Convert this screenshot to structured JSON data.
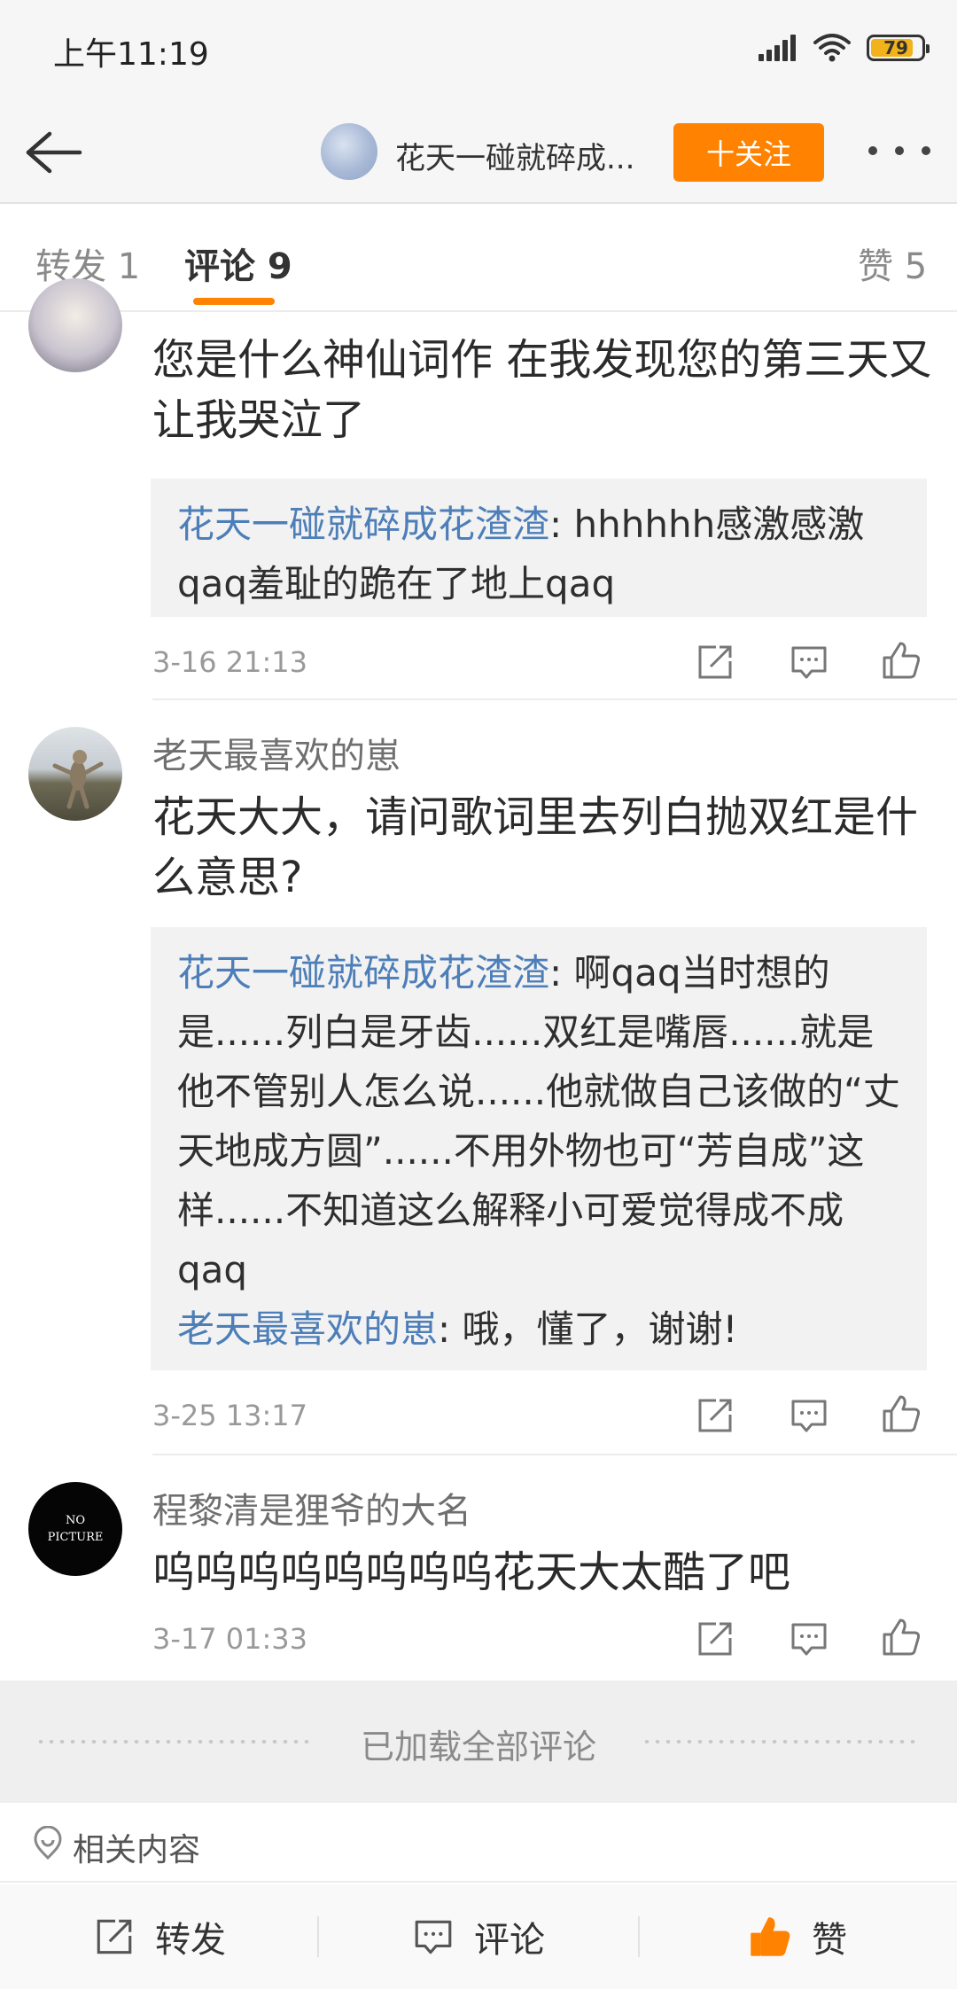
{
  "status_bar": {
    "time": "上午11:19",
    "battery": "79"
  },
  "nav": {
    "title": "花天一碰就碎成...",
    "follow_label": "十关注"
  },
  "tabs": [
    {
      "label": "转发 1"
    },
    {
      "label": "评论 9"
    },
    {
      "label": "赞 5"
    }
  ],
  "comments": [
    {
      "text": "您是什么神仙词作 在我发现您的第三天又让我哭泣了",
      "reply": {
        "author": "花天一碰就碎成花渣渣",
        "text": ": hhhhhh感激感激qaq羞耻的跪在了地上qaq"
      },
      "time": "3-16 21:13"
    },
    {
      "username": "老天最喜欢的崽",
      "text": "花天大大，请问歌词里去列白抛双红是什么意思?",
      "replies": [
        {
          "author": "花天一碰就碎成花渣渣",
          "text": ": 啊qaq当时想的是......列白是牙齿......双红是嘴唇......就是他不管别人怎么说......他就做自己该做的“丈天地成方圆”......不用外物也可“芳自成”这样......不知道这么解释小可爱觉得成不成qaq"
        },
        {
          "author": "老天最喜欢的崽",
          "text": ": 哦，懂了，谢谢!"
        }
      ],
      "time": "3-25 13:17"
    },
    {
      "username": "程黎清是狸爷的大名",
      "avatar_text": [
        "NO",
        "PICTURE"
      ],
      "text": "呜呜呜呜呜呜呜呜花天大太酷了吧",
      "time": "3-17 01:33"
    }
  ],
  "loaded_text": "已加载全部评论",
  "related_label": "相关内容",
  "bottom_bar": {
    "repost": "转发",
    "comment": "评论",
    "like": "赞"
  },
  "colors": {
    "accent": "#ff8200",
    "link": "#4d7eb8"
  },
  "icons": [
    "back-arrow-icon",
    "repost-icon",
    "comment-icon",
    "like-icon",
    "location-pin-icon",
    "wifi-icon",
    "signal-icon",
    "battery-icon"
  ]
}
